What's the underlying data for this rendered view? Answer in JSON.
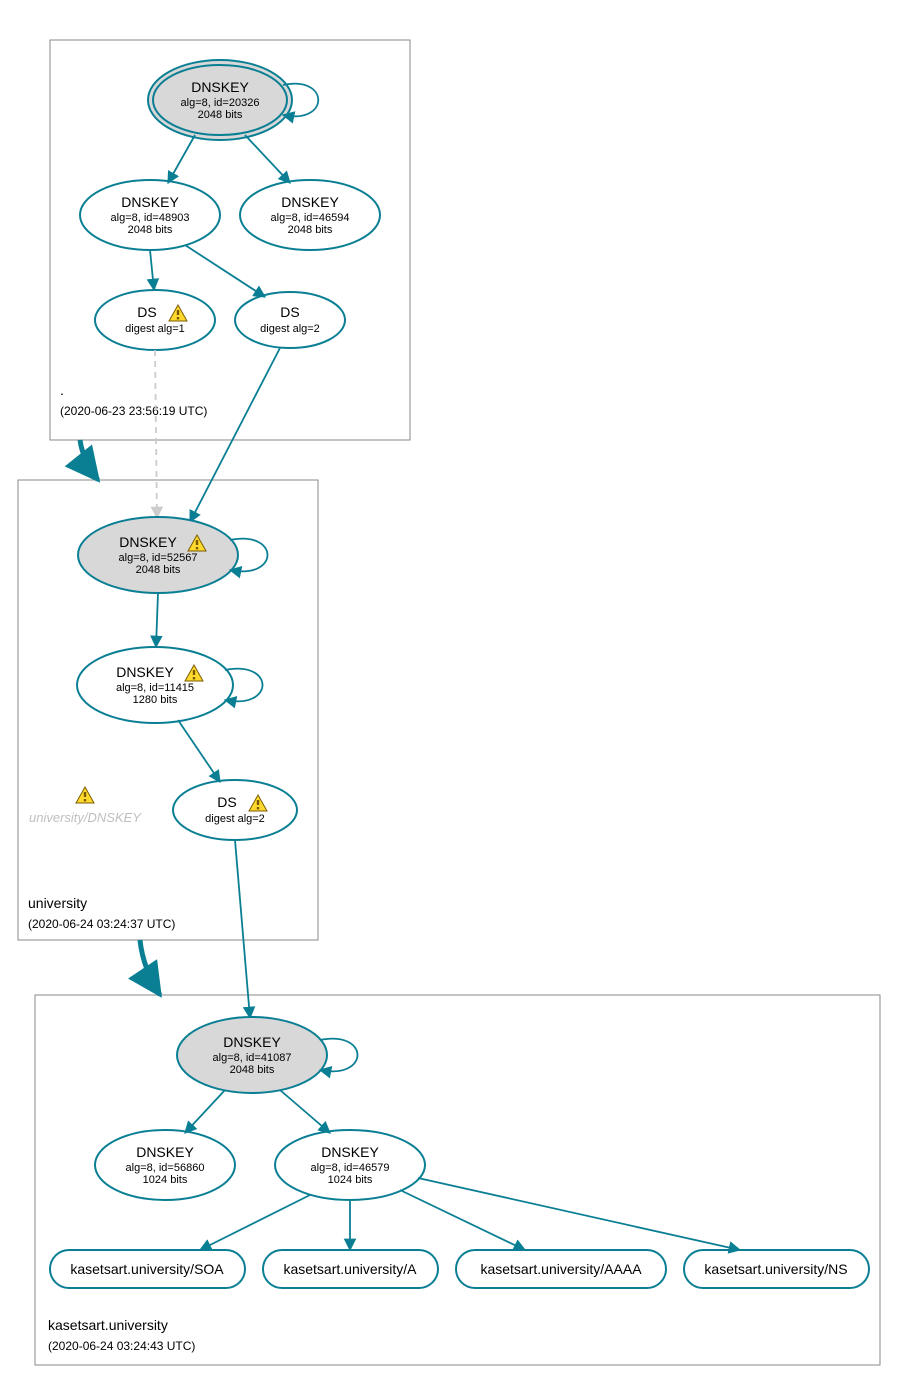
{
  "zones": {
    "root": {
      "label": ".",
      "timestamp": "(2020-06-23 23:56:19 UTC)"
    },
    "university": {
      "label": "university",
      "timestamp": "(2020-06-24 03:24:37 UTC)"
    },
    "kasetsart": {
      "label": "kasetsart.university",
      "timestamp": "(2020-06-24 03:24:43 UTC)"
    }
  },
  "nodes": {
    "root_ksk": {
      "title": "DNSKEY",
      "line1": "alg=8, id=20326",
      "line2": "2048 bits",
      "warn": false
    },
    "root_zsk1": {
      "title": "DNSKEY",
      "line1": "alg=8, id=48903",
      "line2": "2048 bits",
      "warn": false
    },
    "root_zsk2": {
      "title": "DNSKEY",
      "line1": "alg=8, id=46594",
      "line2": "2048 bits",
      "warn": false
    },
    "root_ds1": {
      "title": "DS",
      "line1": "digest alg=1",
      "line2": "",
      "warn": true
    },
    "root_ds2": {
      "title": "DS",
      "line1": "digest alg=2",
      "line2": "",
      "warn": false
    },
    "uni_ksk": {
      "title": "DNSKEY",
      "line1": "alg=8, id=52567",
      "line2": "2048 bits",
      "warn": true
    },
    "uni_zsk": {
      "title": "DNSKEY",
      "line1": "alg=8, id=11415",
      "line2": "1280 bits",
      "warn": true
    },
    "uni_ds": {
      "title": "DS",
      "line1": "digest alg=2",
      "line2": "",
      "warn": true
    },
    "kas_ksk": {
      "title": "DNSKEY",
      "line1": "alg=8, id=41087",
      "line2": "2048 bits",
      "warn": false
    },
    "kas_zsk1": {
      "title": "DNSKEY",
      "line1": "alg=8, id=56860",
      "line2": "1024 bits",
      "warn": false
    },
    "kas_zsk2": {
      "title": "DNSKEY",
      "line1": "alg=8, id=46579",
      "line2": "1024 bits",
      "warn": false
    }
  },
  "ghost": {
    "text": "university/DNSKEY"
  },
  "rr": {
    "soa": "kasetsart.university/SOA",
    "a": "kasetsart.university/A",
    "aaaa": "kasetsart.university/AAAA",
    "ns": "kasetsart.university/NS"
  }
}
